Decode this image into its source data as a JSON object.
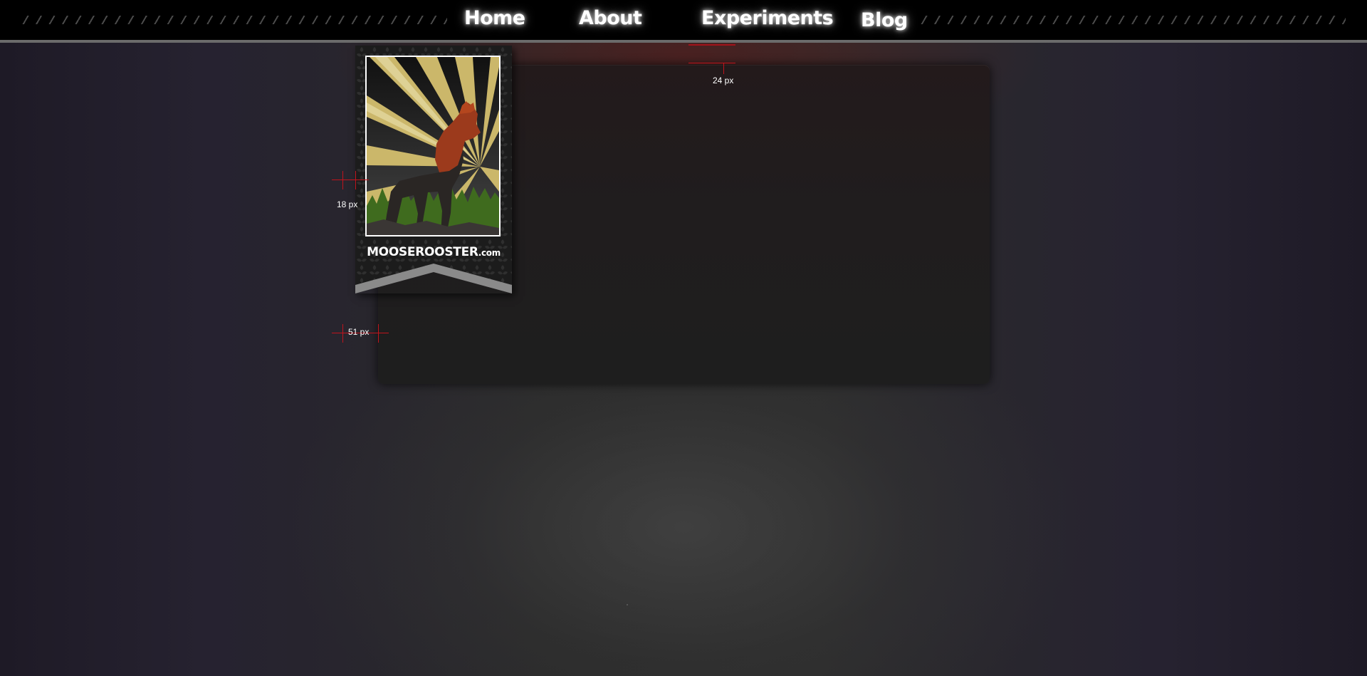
{
  "nav": {
    "items": [
      {
        "label": "Home"
      },
      {
        "label": "About"
      },
      {
        "label": "Experiments",
        "active": true
      },
      {
        "label": "Blog"
      }
    ]
  },
  "logo": {
    "brand": "MOOSEROOSTER",
    "suffix": ".com"
  },
  "annotations": {
    "top_gap": "24 px",
    "left_gap": "18 px",
    "panel_offset": "51 px"
  },
  "colors": {
    "accent_red": "#c0141c",
    "nav_bg": "#000000",
    "panel_bg": "#1f1d1e",
    "rooster_red": "#9c3a1c",
    "tree_green": "#3f6b1e",
    "sunburst_gold": "#c8b560"
  }
}
